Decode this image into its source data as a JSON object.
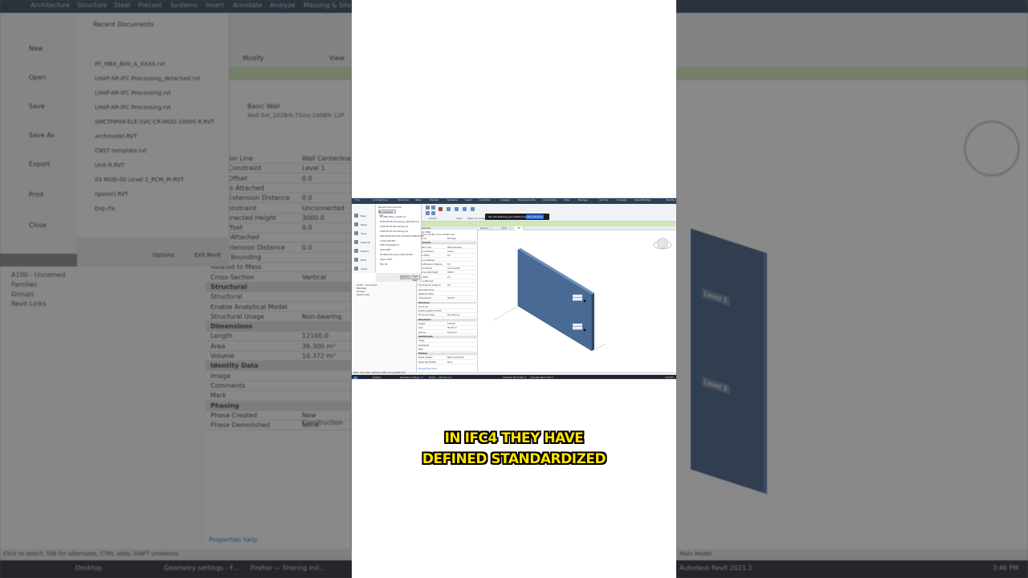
{
  "background": {
    "ribbon_tabs": [
      "Architecture",
      "Structure",
      "Steel",
      "Precast",
      "Systems",
      "Insert",
      "Annotate",
      "Analyze",
      "Massing & Site"
    ],
    "ribbon_groups": [
      "Modify",
      "View"
    ],
    "file_menu": [
      "New",
      "Open",
      "Save",
      "Save As",
      "Export",
      "Print",
      "Close"
    ],
    "recent_title": "Recent Documents",
    "recent_files": [
      "PF_MBX_B00_A_XXXX.rvt",
      "LHAP-AR-IFC Processing_detached.rvt",
      "LHAP-AR-IFC Processing.rvt",
      "LHAP-AR-IFC Processing.rvt",
      "SMCTHP09-ELE-SVC-CR-MOD-10000 R.RVT",
      "archmodel.RVT",
      "CNST template.rvt",
      "Unit-R.RVT",
      "03 MOD-00 Level 2_PCM_Pr.RVT",
      "rgaoncl.RVT",
      "Exp.rfa"
    ],
    "recent_buttons": [
      "Options",
      "Exit Revit"
    ],
    "browser_items": [
      "A100 - Unnamed",
      "Families",
      "Groups",
      "Revit Links"
    ],
    "properties_type": "Basic Wall",
    "properties_type_sub": "Wall Ext_102Brk-75ins-100Blk-12P",
    "properties_rows": [
      {
        "label": "Location Line",
        "value": "Wall Centerline"
      },
      {
        "label": "Base Constraint",
        "value": "Level 1"
      },
      {
        "label": "Base Offset",
        "value": "0.0"
      },
      {
        "label": "Base is Attached",
        "value": ""
      },
      {
        "label": "Base Extension Distance",
        "value": "0.0"
      },
      {
        "label": "Top Constraint",
        "value": "Unconnected"
      },
      {
        "label": "Unconnected Height",
        "value": "3000.0"
      },
      {
        "label": "Top Offset",
        "value": "0.0"
      },
      {
        "label": "Top is Attached",
        "value": ""
      },
      {
        "label": "Top Extension Distance",
        "value": "0.0"
      },
      {
        "label": "Room Bounding",
        "value": ""
      },
      {
        "label": "Related to Mass",
        "value": ""
      },
      {
        "label": "Cross-Section",
        "value": "Vertical"
      },
      {
        "label": "Structural",
        "value": "",
        "group": true
      },
      {
        "label": "Structural",
        "value": ""
      },
      {
        "label": "Enable Analytical Model",
        "value": ""
      },
      {
        "label": "Structural Usage",
        "value": "Non-bearing"
      },
      {
        "label": "Dimensions",
        "value": "",
        "group": true
      },
      {
        "label": "Length",
        "value": "12100.0"
      },
      {
        "label": "Area",
        "value": "36.300 m²"
      },
      {
        "label": "Volume",
        "value": "10.372 m³"
      },
      {
        "label": "Identity Data",
        "value": "",
        "group": true
      },
      {
        "label": "Image",
        "value": ""
      },
      {
        "label": "Comments",
        "value": ""
      },
      {
        "label": "Mark",
        "value": ""
      },
      {
        "label": "Phasing",
        "value": "",
        "group": true
      },
      {
        "label": "Phase Created",
        "value": "New Construction"
      },
      {
        "label": "Phase Demolished",
        "value": "None"
      }
    ],
    "properties_help": "Properties help",
    "status_text": "Click to select, TAB for alternates, CTRL adds, SHIFT unselects.",
    "taskbar": [
      "Desktop",
      "Geometry settings - F...",
      "Firefox — Sharing ind...",
      "Autodesk Revit 2021.1"
    ],
    "model_label": "Main Model",
    "clock": "3:46 PM",
    "level_tags": [
      "Level 1",
      "Level 2"
    ]
  },
  "screen": {
    "ribbon_tabs": [
      "File",
      "Architecture",
      "Structure",
      "Steel",
      "Precast",
      "Systems",
      "Insert",
      "Annotate",
      "Analyze",
      "Massing & Site",
      "Collaborate",
      "View",
      "Manage",
      "Add-Ins",
      "Enscape",
      "Quantification",
      "Modify | Walls"
    ],
    "ribbon_groups": [
      "Modify",
      "View",
      "Measure",
      "Create",
      "Mode",
      "Modify Wall"
    ],
    "share_text": "You are sharing your entire screen.",
    "share_button": "Stop Sharing",
    "file_menu": [
      "New",
      "Open",
      "Save",
      "Save As",
      "Export",
      "Print",
      "Close"
    ],
    "recent_title": "Recent Documents",
    "recent_filter": "By Ordered List",
    "recent_files": [
      "PF_MBX_B00_A_XXXX.rvt",
      "LHAP-AR-IFC Processing_detached.rvt",
      "LHAP-AR-IFC Processing.rvt",
      "LHAP-AR-IFC Processing.rvt",
      "SMCTHP09-ELE-SVC-CR-MOD-10000 R.RVT",
      "archmodel.RVT",
      "CNST template.rvt",
      "Unit-R.RVT",
      "03 MOD-00 Level 2_PCM_Pr.RVT",
      "rgaoncl.RVT",
      "Exp.rfa"
    ],
    "recent_buttons": [
      "Options",
      "Exit Revit"
    ],
    "browser_items": [
      "A100 - Unnamed",
      "Families",
      "Groups",
      "Revit Links"
    ],
    "properties_header": "Properties",
    "properties_type": "Basic Wall",
    "properties_type_sub": "Wall Ext_102Brk-75ins-100Blk-12P",
    "properties_rows": [
      {
        "label": "Walls (1)",
        "value": "Edit Type"
      },
      {
        "label": "Constraints",
        "value": "",
        "group": true
      },
      {
        "label": "Location Line",
        "value": "Wall Centerline"
      },
      {
        "label": "Base Constraint",
        "value": "Level 1"
      },
      {
        "label": "Base Offset",
        "value": "0.0"
      },
      {
        "label": "Base is Attached",
        "value": ""
      },
      {
        "label": "Base Extension Distance",
        "value": "0.0"
      },
      {
        "label": "Top Constraint",
        "value": "Unconnected"
      },
      {
        "label": "Unconnected Height",
        "value": "3000.0"
      },
      {
        "label": "Top Offset",
        "value": "0.0"
      },
      {
        "label": "Top is Attached",
        "value": ""
      },
      {
        "label": "Top Extension Distance",
        "value": "0.0"
      },
      {
        "label": "Room Bounding",
        "value": ""
      },
      {
        "label": "Related to Mass",
        "value": ""
      },
      {
        "label": "Cross-Section",
        "value": "Vertical"
      },
      {
        "label": "Structural",
        "value": "",
        "group": true
      },
      {
        "label": "Structural",
        "value": ""
      },
      {
        "label": "Enable Analytical Model",
        "value": ""
      },
      {
        "label": "Structural Usage",
        "value": "Non-bearing"
      },
      {
        "label": "Dimensions",
        "value": "",
        "group": true
      },
      {
        "label": "Length",
        "value": "12100.0"
      },
      {
        "label": "Area",
        "value": "36.300 m²"
      },
      {
        "label": "Volume",
        "value": "10.372 m³"
      },
      {
        "label": "Identity Data",
        "value": "",
        "group": true
      },
      {
        "label": "Image",
        "value": ""
      },
      {
        "label": "Comments",
        "value": ""
      },
      {
        "label": "Mark",
        "value": ""
      },
      {
        "label": "Phasing",
        "value": "",
        "group": true
      },
      {
        "label": "Phase Created",
        "value": "New Construction"
      },
      {
        "label": "Phase Demolished",
        "value": "None"
      }
    ],
    "properties_help": "Properties help",
    "view_tabs": [
      "Level 1",
      "{3D}",
      "3D"
    ],
    "level_tags": [
      "Level 1",
      "Level 2"
    ],
    "status_text": "Walls : Basic Wall : Wall Ext_102Brk-75ins-100Blk-12P",
    "taskbar": [
      "Desktop",
      "Geometry settings - F...",
      "Firefox — Sharing ind...",
      "Autodesk Revit 2021.1",
      "Autodesk Revit 2021.1"
    ],
    "clock": "3:46 PM"
  },
  "caption": {
    "line1": "IN IFC4 THEY HAVE",
    "line2": "DEFINED STANDARDIZED"
  },
  "colors": {
    "caption_fill": "#ffe500",
    "caption_stroke": "#000000",
    "wall": "#4a6a96",
    "ribbon_tab_bar": "#2d3e58",
    "modify_bar": "#cfe9b1"
  }
}
